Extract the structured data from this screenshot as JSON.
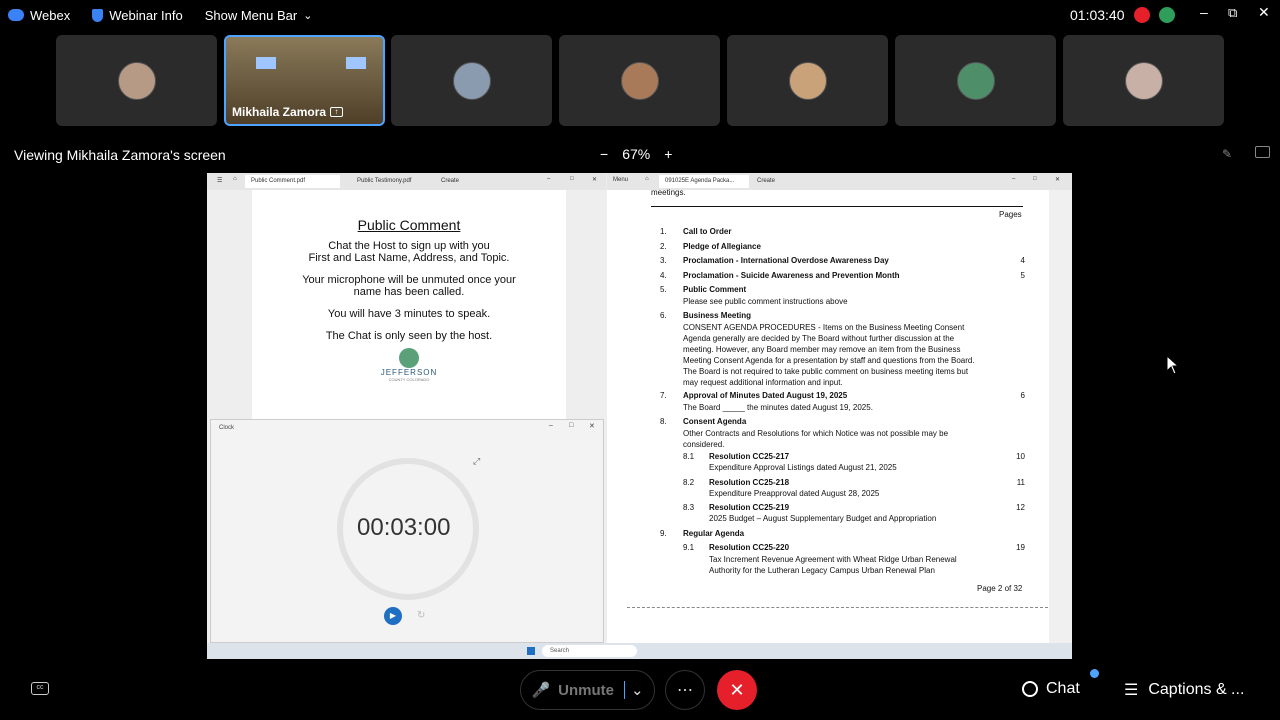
{
  "topbar": {
    "app": "Webex",
    "webinar_info": "Webinar Info",
    "show_menu_bar": "Show Menu Bar",
    "timer": "01:03:40"
  },
  "participants": [
    {
      "name": ""
    },
    {
      "name": "Mikhaila Zamora"
    },
    {
      "name": ""
    },
    {
      "name": ""
    },
    {
      "name": ""
    },
    {
      "name": ""
    },
    {
      "name": ""
    }
  ],
  "share": {
    "viewing": "Viewing Mikhaila Zamora's screen",
    "zoom": "67%",
    "minus": "−",
    "plus": "+"
  },
  "browser_left": {
    "tab1": "Public Comment.pdf",
    "tab2": "Public Testimony.pdf",
    "tab3": "Create"
  },
  "public_comment": {
    "title": "Public Comment",
    "line1": "Chat the Host to sign up with you",
    "line2": "First and Last Name, Address, and Topic.",
    "line3": "Your microphone will be unmuted once your",
    "line4": "name has been called.",
    "line5": "You will have 3 minutes to speak.",
    "line6": "The Chat is only seen by the host.",
    "logo_text": "JEFFERSON",
    "logo_sub": "COUNTY COLORADO"
  },
  "clock": {
    "title": "Clock",
    "time": "00:03:00"
  },
  "browser_right": {
    "menu": "Menu",
    "tab": "091025E Agenda Packa...",
    "create": "Create"
  },
  "agenda": {
    "top_text": "meetings.",
    "pages_header": "Pages",
    "footer": "Page 2 of 32",
    "items": [
      {
        "num": "1.",
        "title": "Call to Order",
        "page": "",
        "desc": ""
      },
      {
        "num": "2.",
        "title": "Pledge of Allegiance",
        "page": "",
        "desc": ""
      },
      {
        "num": "3.",
        "title": "Proclamation - International Overdose Awareness Day",
        "page": "4",
        "desc": ""
      },
      {
        "num": "4.",
        "title": "Proclamation - Suicide Awareness and Prevention Month",
        "page": "5",
        "desc": ""
      },
      {
        "num": "5.",
        "title": "Public Comment",
        "page": "",
        "desc": "Please see public comment instructions above"
      },
      {
        "num": "6.",
        "title": "Business Meeting",
        "page": "",
        "desc": "CONSENT AGENDA PROCEDURES - Items on the Business Meeting Consent Agenda generally are decided by The Board without further discussion at the meeting. However, any Board member may remove an item from the Business Meeting Consent Agenda for a presentation by staff and questions from the Board. The Board is not required to take public comment on business meeting items but may request additional information and input."
      },
      {
        "num": "7.",
        "title": "Approval of Minutes Dated August 19, 2025",
        "page": "6",
        "desc": "The Board _____ the minutes dated August 19, 2025."
      },
      {
        "num": "8.",
        "title": "Consent Agenda",
        "page": "",
        "desc": "Other Contracts and Resolutions for which Notice was not possible may be considered."
      },
      {
        "num": "9.",
        "title": "Regular Agenda",
        "page": "",
        "desc": ""
      }
    ],
    "subitems": [
      {
        "num": "8.1",
        "title": "Resolution CC25-217",
        "page": "10",
        "desc": "Expenditure Approval Listings dated August 21, 2025"
      },
      {
        "num": "8.2",
        "title": "Resolution CC25-218",
        "page": "11",
        "desc": "Expenditure Preapproval dated August 28, 2025"
      },
      {
        "num": "8.3",
        "title": "Resolution CC25-219",
        "page": "12",
        "desc": "2025 Budget – August Supplementary Budget and Appropriation"
      },
      {
        "num": "9.1",
        "title": "Resolution CC25-220",
        "page": "19",
        "desc": "Tax Increment Revenue Agreement with Wheat Ridge Urban Renewal Authority for the Lutheran Legacy Campus Urban Renewal Plan"
      }
    ]
  },
  "taskbar": {
    "search": "Search"
  },
  "controls": {
    "unmute": "Unmute",
    "chat": "Chat",
    "captions": "Captions & ..."
  },
  "colors": {
    "end_call": "#e5202a",
    "accent": "#4da3ff"
  }
}
